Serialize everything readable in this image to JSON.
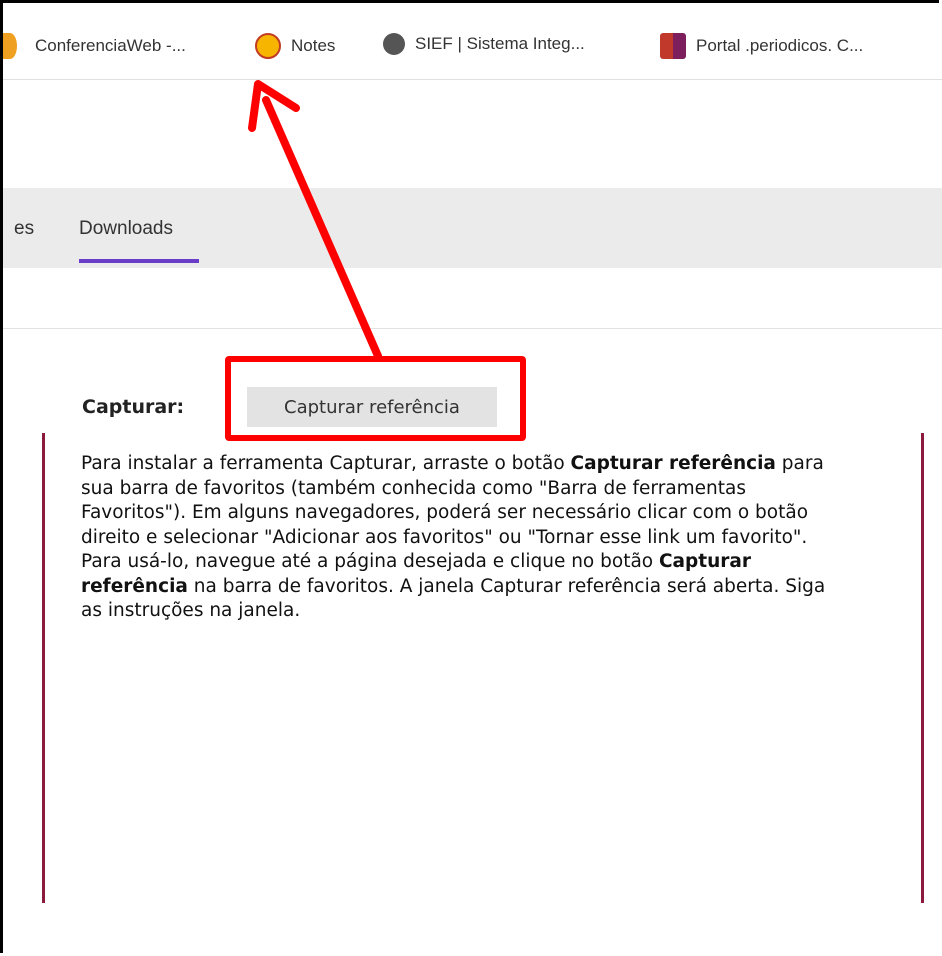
{
  "bookmarks": [
    {
      "label": "ConferenciaWeb -...",
      "icon": "conferenciaweb-icon"
    },
    {
      "label": "Notes",
      "icon": "notes-icon"
    },
    {
      "label": "SIEF | Sistema Integ...",
      "icon": "globe-icon"
    },
    {
      "label": "Portal .periodicos. C...",
      "icon": "portal-periodicos-icon"
    }
  ],
  "tabs": {
    "partial_label": "es",
    "downloads_label": "Downloads"
  },
  "capture": {
    "label": "Capturar:",
    "button_label": "Capturar referência"
  },
  "description": {
    "p1_a": "Para instalar a ferramenta Capturar, arraste o botão ",
    "p1_bold1": "Capturar referência",
    "p1_b": " para sua barra de favoritos (também conhecida como \"Barra de ferramentas Favoritos\"). Em alguns navegadores, poderá ser necessário clicar com o botão direito e selecionar \"Adicionar aos favoritos\" ou \"Tornar esse link um favorito\".",
    "p2_a": "Para usá-lo, navegue até a página desejada e clique no botão ",
    "p2_bold": "Capturar referência",
    "p2_b": " na barra de favoritos. A janela Capturar referência será aberta. Siga as instruções na janela."
  },
  "colors": {
    "accent_tab": "#6a3dc8",
    "annotation_red": "#ff0000",
    "side_line": "#8b1a3c"
  }
}
